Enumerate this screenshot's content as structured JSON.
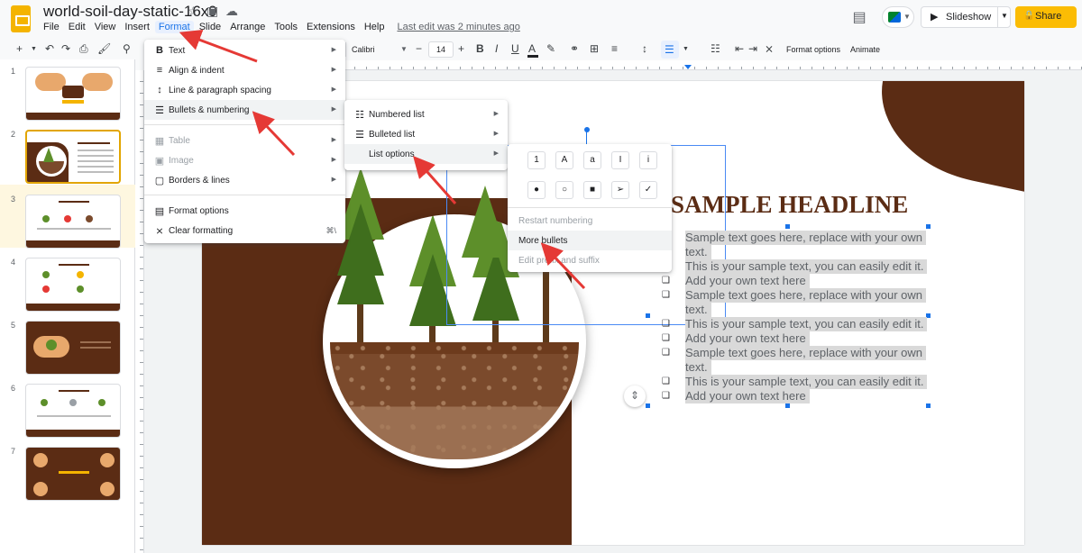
{
  "header": {
    "doc_title": "world-soil-day-static-16x9",
    "menus": [
      "File",
      "Edit",
      "View",
      "Insert",
      "Format",
      "Slide",
      "Arrange",
      "Tools",
      "Extensions",
      "Help"
    ],
    "last_edit": "Last edit was 2 minutes ago",
    "slideshow_label": "Slideshow",
    "share_label": "Share"
  },
  "toolbar": {
    "font_name": "Calibri",
    "font_size": "14",
    "format_options": "Format options",
    "animate": "Animate"
  },
  "format_menu": {
    "items": [
      {
        "icon": "B",
        "label": "Text"
      },
      {
        "icon": "≡",
        "label": "Align & indent"
      },
      {
        "icon": "↕",
        "label": "Line & paragraph spacing"
      },
      {
        "icon": "☰",
        "label": "Bullets & numbering"
      },
      {
        "icon": "▦",
        "label": "Table"
      },
      {
        "icon": "▣",
        "label": "Image"
      },
      {
        "icon": "▢",
        "label": "Borders & lines"
      },
      {
        "icon": "▤",
        "label": "Format options"
      },
      {
        "icon": "⨯",
        "label": "Clear formatting",
        "shortcut": "⌘\\"
      }
    ]
  },
  "bullets_submenu": {
    "items": [
      {
        "icon": "☷",
        "label": "Numbered list"
      },
      {
        "icon": "☰",
        "label": "Bulleted list"
      },
      {
        "label": "List options"
      }
    ]
  },
  "list_options": {
    "number_glyphs": [
      "1",
      "A",
      "a",
      "I",
      "i"
    ],
    "bullet_glyphs": [
      "●",
      "○",
      "■",
      "➢",
      "✓"
    ],
    "restart_numbering": "Restart numbering",
    "more_bullets": "More bullets",
    "edit_prefix": "Edit prefix and suffix"
  },
  "slide": {
    "headline": "SAMPLE HEADLINE",
    "list_lines": [
      {
        "bullet": "",
        "text": "Sample text goes here, replace with your own"
      },
      {
        "bullet": "",
        "text": "text."
      },
      {
        "bullet": "❑",
        "text": "This is your sample text, you can easily edit it."
      },
      {
        "bullet": "❑",
        "text": "Add your own text here"
      },
      {
        "bullet": "❑",
        "text": "Sample text goes here, replace with your own"
      },
      {
        "bullet": "",
        "text": "text."
      },
      {
        "bullet": "❑",
        "text": "This is your sample text, you can easily edit it."
      },
      {
        "bullet": "❑",
        "text": "Add your own text here"
      },
      {
        "bullet": "❑",
        "text": "Sample text goes here, replace with your own"
      },
      {
        "bullet": "",
        "text": "text."
      },
      {
        "bullet": "❑",
        "text": "This is your sample text, you can easily edit it."
      },
      {
        "bullet": "❑",
        "text": "Add your own text here"
      }
    ]
  },
  "filmstrip": {
    "numbers": [
      "1",
      "2",
      "3",
      "4",
      "5",
      "6",
      "7"
    ],
    "selected": "2"
  },
  "colors": {
    "accent": "#1a73e8",
    "brand_yellow": "#fbbc04",
    "soil_brown": "#5b2c14",
    "arrow_red": "#e53935"
  }
}
